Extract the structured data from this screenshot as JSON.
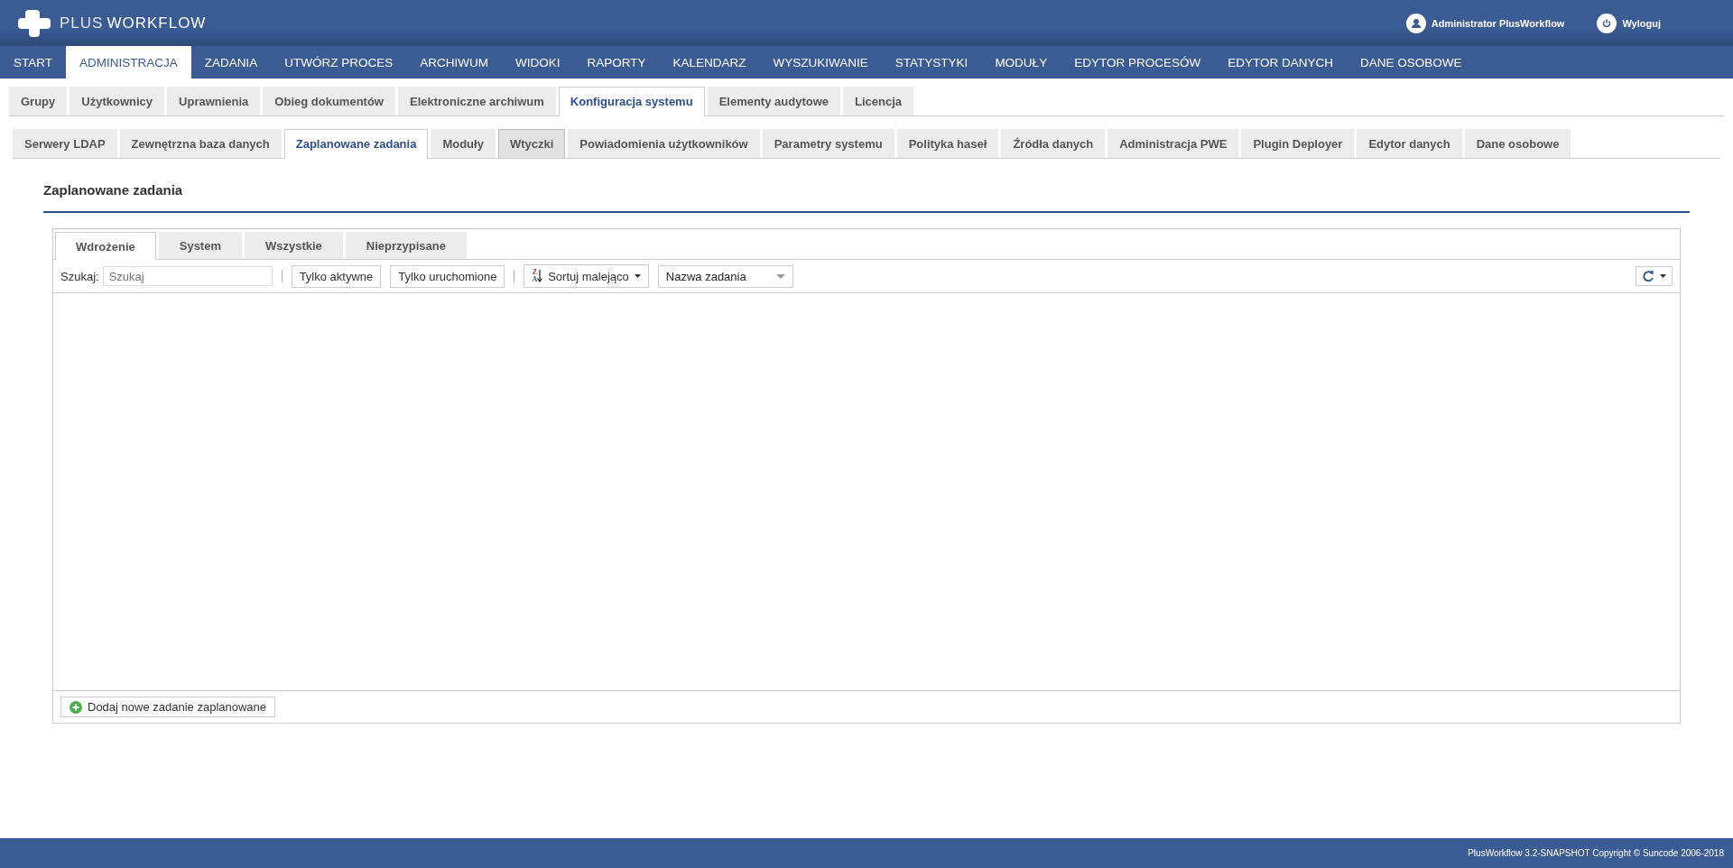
{
  "header": {
    "logo_prefix": "PLUS",
    "logo_suffix": "WORKFLOW",
    "user": "Administrator PlusWorkflow",
    "logout": "Wyloguj"
  },
  "main_menu": [
    {
      "label": "START",
      "selected": false
    },
    {
      "label": "ADMINISTRACJA",
      "selected": true
    },
    {
      "label": "ZADANIA",
      "selected": false
    },
    {
      "label": "UTWÓRZ PROCES",
      "selected": false
    },
    {
      "label": "ARCHIWUM",
      "selected": false
    },
    {
      "label": "WIDOKI",
      "selected": false
    },
    {
      "label": "RAPORTY",
      "selected": false
    },
    {
      "label": "KALENDARZ",
      "selected": false
    },
    {
      "label": "WYSZUKIWANIE",
      "selected": false
    },
    {
      "label": "STATYSTYKI",
      "selected": false
    },
    {
      "label": "MODUŁY",
      "selected": false
    },
    {
      "label": "EDYTOR PROCESÓW",
      "selected": false
    },
    {
      "label": "EDYTOR DANYCH",
      "selected": false
    },
    {
      "label": "DANE OSOBOWE",
      "selected": false
    }
  ],
  "admin_tabs": [
    {
      "label": "Grupy",
      "selected": false
    },
    {
      "label": "Użytkownicy",
      "selected": false
    },
    {
      "label": "Uprawnienia",
      "selected": false
    },
    {
      "label": "Obieg dokumentów",
      "selected": false
    },
    {
      "label": "Elektroniczne archiwum",
      "selected": false
    },
    {
      "label": "Konfiguracja systemu",
      "selected": true
    },
    {
      "label": "Elementy audytowe",
      "selected": false
    },
    {
      "label": "Licencja",
      "selected": false
    }
  ],
  "config_tabs": [
    {
      "label": "Serwery LDAP",
      "selected": false,
      "hovered": false
    },
    {
      "label": "Zewnętrzna baza danych",
      "selected": false,
      "hovered": false
    },
    {
      "label": "Zaplanowane zadania",
      "selected": true,
      "hovered": false
    },
    {
      "label": "Moduły",
      "selected": false,
      "hovered": false
    },
    {
      "label": "Wtyczki",
      "selected": false,
      "hovered": true
    },
    {
      "label": "Powiadomienia użytkowników",
      "selected": false,
      "hovered": false
    },
    {
      "label": "Parametry systemu",
      "selected": false,
      "hovered": false
    },
    {
      "label": "Polityka haseł",
      "selected": false,
      "hovered": false
    },
    {
      "label": "Źródła danych",
      "selected": false,
      "hovered": false
    },
    {
      "label": "Administracja PWE",
      "selected": false,
      "hovered": false
    },
    {
      "label": "Plugin Deployer",
      "selected": false,
      "hovered": false
    },
    {
      "label": "Edytor danych",
      "selected": false,
      "hovered": false
    },
    {
      "label": "Dane osobowe",
      "selected": false,
      "hovered": false
    }
  ],
  "section_title": "Zaplanowane zadania",
  "task_tabs": [
    {
      "label": "Wdrożenie",
      "selected": true
    },
    {
      "label": "System",
      "selected": false
    },
    {
      "label": "Wszystkie",
      "selected": false
    },
    {
      "label": "Nieprzypisane",
      "selected": false
    }
  ],
  "toolbar": {
    "search_label": "Szukaj:",
    "search_placeholder": "Szukaj",
    "active_only": "Tylko aktywne",
    "running_only": "Tylko uruchomione",
    "sort": "Sortuj malejąco",
    "sort_icon_top": "Z",
    "sort_icon_bottom": "A",
    "sort_field": "Nazwa zadania"
  },
  "add_button": "Dodaj nowe zadanie zaplanowane",
  "footer": "PlusWorkflow 3.2-SNAPSHOT Copyright © Suncode 2006-2018"
}
